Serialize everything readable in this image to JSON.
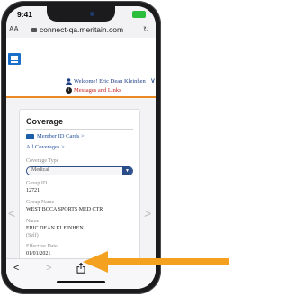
{
  "statusbar": {
    "time": "9:41"
  },
  "browser": {
    "aa_label": "AA",
    "url": "connect-qa.meritain.com",
    "reload_glyph": "↻"
  },
  "header": {
    "welcome": "Welcome! Eric Dean Kleinhen",
    "messages": "Messages and Links",
    "chevron": "∨"
  },
  "card": {
    "title": "Coverage",
    "member_id_link": "Member ID Cards >",
    "all_coverages_link": "All Coverages >",
    "fields": {
      "coverage_type_label": "Coverage Type",
      "coverage_type_value": "Medical",
      "group_id_label": "Group ID",
      "group_id_value": "12721",
      "group_name_label": "Group Name",
      "group_name_value": "WEST BOCA SPORTS MED CTR",
      "name_label": "Name",
      "name_value": "ERIC DEAN KLEINHEN",
      "relationship_value": "(Self)",
      "effective_date_label": "Effective Date",
      "effective_date_value": "01/01/2021"
    }
  },
  "toolbar": {
    "back_glyph": "<",
    "forward_glyph": ">"
  },
  "side_arrows": {
    "left": "<",
    "right": ">"
  },
  "colors": {
    "accent_orange": "#f4a11f",
    "link_blue": "#1e4f9a",
    "header_orange_line": "#e98a23",
    "alert_red": "#c21f1f"
  }
}
